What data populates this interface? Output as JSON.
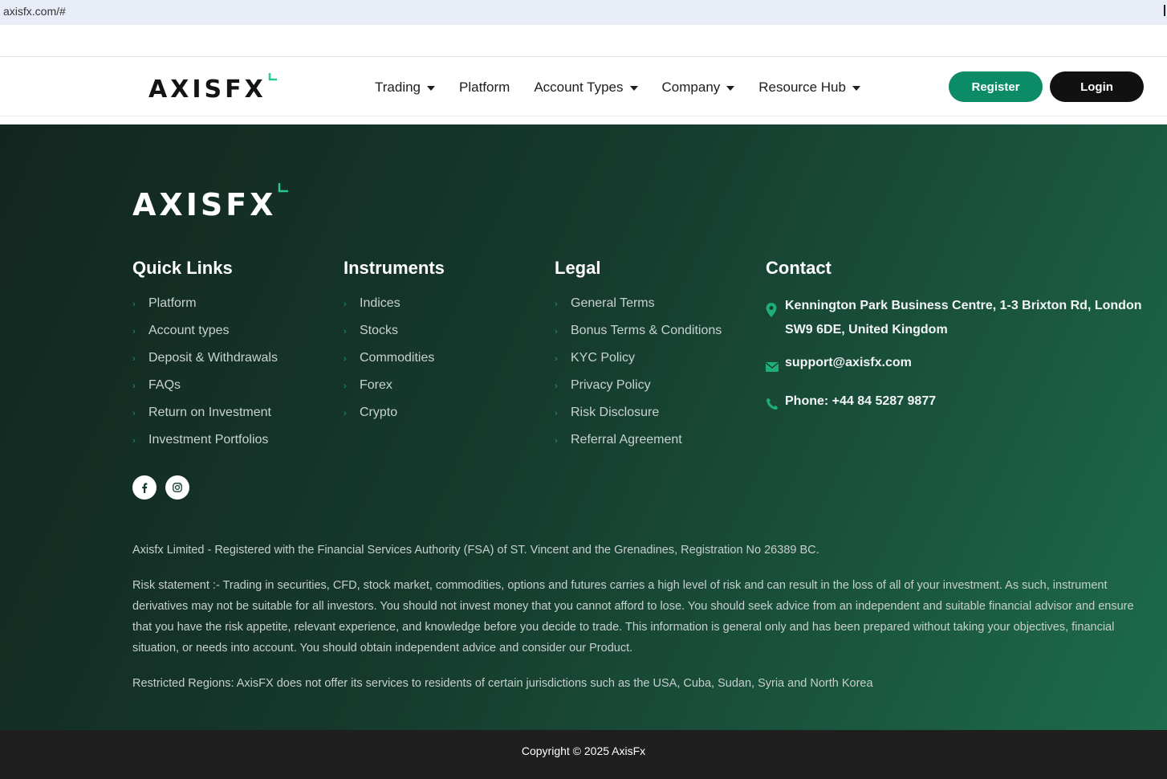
{
  "browser": {
    "url": "axisfx.com/#"
  },
  "brand": {
    "name": "AXISFX",
    "accent": "#0c8c66",
    "accent_light": "#29c98d"
  },
  "nav": {
    "items": [
      {
        "label": "Trading",
        "dropdown": true
      },
      {
        "label": "Platform",
        "dropdown": false
      },
      {
        "label": "Account Types",
        "dropdown": true
      },
      {
        "label": "Company",
        "dropdown": true
      },
      {
        "label": "Resource Hub",
        "dropdown": true
      }
    ],
    "register_label": "Register",
    "login_label": "Login"
  },
  "footer": {
    "quick_links": {
      "title": "Quick Links",
      "items": [
        "Platform",
        "Account types",
        "Deposit & Withdrawals",
        "FAQs",
        "Return on Investment",
        "Investment Portfolios"
      ]
    },
    "instruments": {
      "title": "Instruments",
      "items": [
        "Indices",
        "Stocks",
        "Commodities",
        "Forex",
        "Crypto"
      ]
    },
    "legal": {
      "title": "Legal",
      "items": [
        "General Terms",
        "Bonus Terms & Conditions",
        "KYC Policy",
        "Privacy Policy",
        "Risk Disclosure",
        "Referral Agreement"
      ]
    },
    "contact": {
      "title": "Contact",
      "address": "Kennington Park Business Centre, 1-3 Brixton Rd, London SW9 6DE, United Kingdom",
      "email": "support@axisfx.com",
      "phone": "Phone: +44 84 5287 9877"
    },
    "social": [
      "facebook-icon",
      "instagram-icon"
    ],
    "registration": "Axisfx Limited - Registered with the Financial Services Authority (FSA) of ST. Vincent and the Grenadines, Registration No 26389 BC.",
    "risk_statement": "Risk statement :- Trading in securities, CFD, stock market, commodities, options and futures carries a high level of risk and can result in the loss of all of your investment. As such, instrument derivatives may not be suitable for all investors. You should not invest money that you cannot afford to lose. You should seek advice from an independent and suitable financial advisor and ensure that you have the risk appetite, relevant experience, and knowledge before you decide to trade. This information is general only and has been prepared without taking your objectives, financial situation, or needs into account. You should obtain independent advice and consider our Product.",
    "restricted": "Restricted Regions: AxisFX does not offer its services to residents of certain jurisdictions such as the USA, Cuba, Sudan, Syria and North Korea",
    "copyright": "Copyright © 2025 AxisFx"
  }
}
